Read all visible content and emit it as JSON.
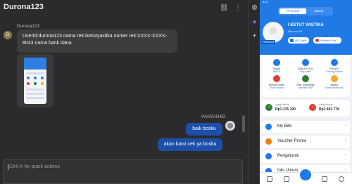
{
  "chat": {
    "title": "Durona123",
    "incoming": {
      "sender": "Durona123",
      "avatar_letter": "D",
      "text": "UserId:durona123 nama rek:iketutyastika nomer rek:XXXX-XXXX-8043 nama bank dana"
    },
    "outgoing": {
      "sender": "PANTAU4D",
      "messages": [
        "baik bosku",
        "akan kami cek ya bosku"
      ]
    },
    "input": {
      "placeholder": "Ctrl+K for quick actions"
    }
  },
  "phone": {
    "status_time": "4:41",
    "segments": [
      "Personal",
      "Bisnis"
    ],
    "profile": {
      "name": "I KETUT YASTIKA",
      "phone": "08••••••••43",
      "badge": "PREMIUM",
      "qr_label": "QR Saya",
      "protection_label": "Proteksi Kita"
    },
    "services": [
      {
        "name": "Saldo",
        "sub": "Rp827",
        "color": "#1f7ae6"
      },
      {
        "name": "DANA CICIL",
        "sub": "Pay Later",
        "color": "#1f7ae6"
      },
      {
        "name": "DANA+",
        "sub": "Untung Harian",
        "color": "#1f7ae6"
      },
      {
        "name": "DANA Goals",
        "sub": "Buat Impian",
        "color": "#e53935"
      },
      {
        "name": "Rek. Keluarga",
        "sub": "Aktivasi Yuk!",
        "color": "#2e7d32"
      },
      {
        "name": "eMAS",
        "sub": "Mulai Invest Yuk",
        "color": "#f9a825"
      }
    ],
    "flow": {
      "in_label": "Uang Masuk",
      "in_value": "Rp1.376.100",
      "out_label": "Uang Keluar",
      "out_value": "Rp1.401.778"
    },
    "menu": [
      {
        "label": "My Bills",
        "color": "#1f7ae6"
      },
      {
        "label": "Voucher Promo",
        "color": "#f57c00"
      },
      {
        "label": "Pengaturan",
        "color": "#1f7ae6"
      },
      {
        "label": "Info Umum",
        "color": "#1f7ae6"
      }
    ]
  }
}
